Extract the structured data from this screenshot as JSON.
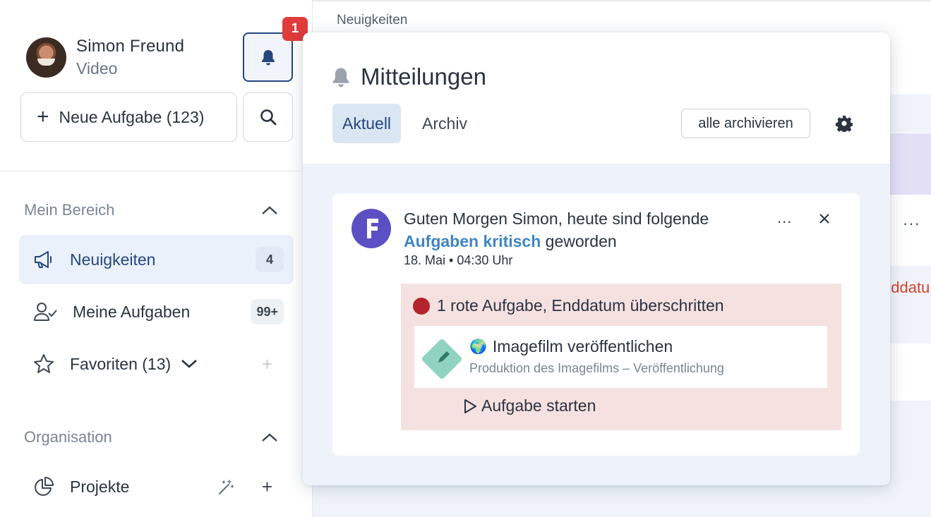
{
  "user": {
    "name": "Simon Freund",
    "role": "Video"
  },
  "notifications": {
    "badge_count": "1"
  },
  "sidebar": {
    "new_task_label": "Neue Aufgabe (123)",
    "sections": [
      {
        "title": "Mein Bereich",
        "items": [
          {
            "label": "Neuigkeiten",
            "count": "4",
            "icon": "megaphone-icon",
            "active": true
          },
          {
            "label": "Meine Aufgaben",
            "count": "99+",
            "icon": "user-check-icon"
          },
          {
            "label": "Favoriten (13)",
            "icon": "star-icon"
          }
        ]
      },
      {
        "title": "Organisation",
        "items": [
          {
            "label": "Projekte",
            "icon": "pie-chart-icon"
          }
        ]
      }
    ]
  },
  "main": {
    "breadcrumb": "Neuigkeiten",
    "partial_red_text": "dddatu"
  },
  "panel": {
    "title": "Mitteilungen",
    "tabs": [
      {
        "label": "Aktuell",
        "active": true
      },
      {
        "label": "Archiv"
      }
    ],
    "archive_all_label": "alle archivieren",
    "notification": {
      "text_before": "Guten Morgen Simon, heute sind folgende ",
      "text_highlight": "Aufgaben kritisch",
      "text_after": " geworden",
      "time": "18. Mai • 04:30 Uhr",
      "more": "...",
      "alert": {
        "heading": "1 rote Aufgabe, Enddatum überschritten",
        "task_title": "Imagefilm veröffentlichen",
        "task_subtitle": "Produktion des Imagefilms – Veröffentlichung",
        "start_label": "Aufgabe starten"
      }
    }
  },
  "colors": {
    "accent": "#24477d",
    "badge": "#e03c3c",
    "highlight_link": "#3f86c4",
    "alert_bg": "#f6e1e1",
    "red_dot": "#b5232c",
    "logo_bg": "#5c4fc4"
  }
}
